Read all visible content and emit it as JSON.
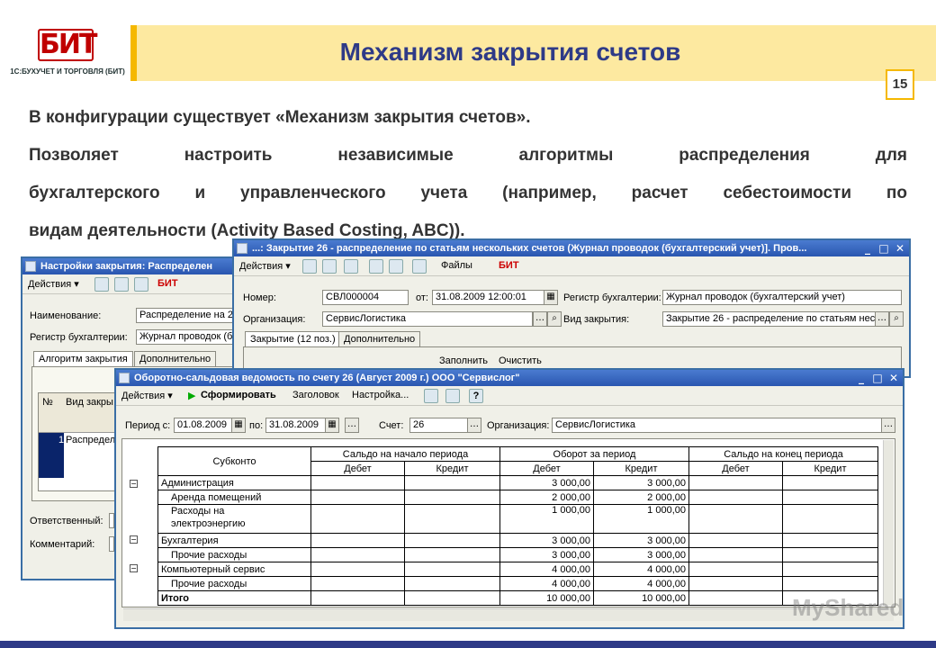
{
  "slide": {
    "logo_mark": "БИТ",
    "logo_text": "1С:БУХУЧЕТ И ТОРГОВЛЯ (БИТ)",
    "title": "Механизм закрытия счетов",
    "page_number": "15",
    "para1": "В конфигурации существует «Механизм закрытия счетов».",
    "para2_line1": "Позволяет настроить независимые алгоритмы распределения для",
    "para2_line2": "бухгалтерского и управленческого учета (например, расчет себестоимости по",
    "para2_line3": "видам деятельности (Activity Based Costing, ABC)).",
    "colors": {
      "accent": "#f5b800",
      "title": "#2e3a87",
      "logo": "#c00000"
    }
  },
  "win_settings": {
    "title": "Настройки закрытия: Распределен",
    "actions": "Действия ▾",
    "name_label": "Наименование:",
    "name_value": "Распределение на 2",
    "register_label": "Регистр бухгалтерии:",
    "register_value": "Журнал проводок (б",
    "tab1": "Алгоритм закрытия",
    "tab2": "Дополнительно",
    "col_no": "№",
    "col_type": "Вид закры",
    "row_no": "1",
    "row_value": "Распредел",
    "responsible_label": "Ответственный:",
    "comment_label": "Комментарий:"
  },
  "win_closing": {
    "title": "...: Закрытие 26 - распределение по статьям нескольких счетов (Журнал проводок (бухгалтерский учет)]. Пров...",
    "actions": "Действия ▾",
    "files": "Файлы",
    "number_label": "Номер:",
    "number_value": "СВЛ000004",
    "from_label": "от:",
    "date_value": "31.08.2009 12:00:01",
    "register_label": "Регистр бухгалтерии:",
    "register_value": "Журнал проводок (бухгалтерский учет)",
    "org_label": "Организация:",
    "org_value": "СервисЛогистика",
    "type_label": "Вид закрытия:",
    "type_value": "Закрытие 26 - распределение по статьям неск",
    "tab1": "Закрытие (12 поз.)",
    "tab2": "Дополнительно",
    "fill": "Заполнить",
    "clear": "Очистить"
  },
  "win_report": {
    "title": "Оборотно-сальдовая ведомость по счету 26 (Август 2009 г.) ООО \"Сервислог\"",
    "actions": "Действия ▾",
    "generate": "Сформировать",
    "header_btn": "Заголовок",
    "settings_btn": "Настройка...",
    "period_from_label": "Период с:",
    "period_from": "01.08.2009",
    "period_to_label": "по:",
    "period_to": "31.08.2009",
    "account_label": "Счет:",
    "account_value": "26",
    "org_label": "Организация:",
    "org_value": "СервисЛогистика",
    "table": {
      "h_subconto": "Субконто",
      "h_start": "Сальдо на начало периода",
      "h_turnover": "Оборот за период",
      "h_end": "Сальдо на конец периода",
      "h_debit": "Дебет",
      "h_credit": "Кредит",
      "rows": [
        {
          "name": "Администрация",
          "d": "3 000,00",
          "c": "3 000,00"
        },
        {
          "name": "Аренда помещений",
          "d": "2 000,00",
          "c": "2 000,00"
        },
        {
          "name": "Расходы на",
          "name2": "электроэнергию",
          "d": "1 000,00",
          "c": "1 000,00"
        },
        {
          "name": "Бухгалтерия",
          "d": "3 000,00",
          "c": "3 000,00"
        },
        {
          "name": "Прочие расходы",
          "d": "3 000,00",
          "c": "3 000,00"
        },
        {
          "name": "Компьютерный сервис",
          "d": "4 000,00",
          "c": "4 000,00"
        },
        {
          "name": "Прочие расходы",
          "d": "4 000,00",
          "c": "4 000,00"
        }
      ],
      "total_label": "Итого",
      "total_d": "10 000,00",
      "total_c": "10 000,00"
    }
  },
  "watermark": "MyShared"
}
